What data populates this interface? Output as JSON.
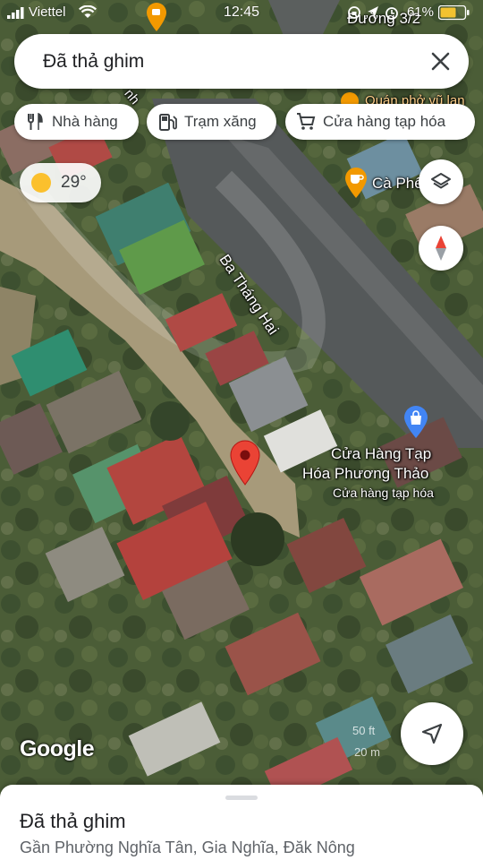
{
  "status_bar": {
    "carrier": "Viettel",
    "time": "12:45",
    "battery": "61%"
  },
  "search": {
    "query": "Đã thả ghim"
  },
  "chips": [
    {
      "label": "Nhà hàng",
      "icon": "restaurant-icon"
    },
    {
      "label": "Trạm xăng",
      "icon": "gas-station-icon"
    },
    {
      "label": "Cửa hàng tạp hóa",
      "icon": "shopping-cart-icon"
    }
  ],
  "weather": {
    "temperature": "29°",
    "icon": "sun-icon"
  },
  "map": {
    "street_labels": {
      "top_right": "Đường 3/2",
      "diagonal": "Ba Tháng Hai",
      "top_left": "nh"
    },
    "places": {
      "noodle_shop": "Quán phở vũ lan",
      "cafe": "Cà Phê",
      "store_name": "Cửa Hàng Tạp Hóa Phương Thảo",
      "store_line1": "Cửa Hàng Tạp",
      "store_line2": "Hóa Phương Thảo",
      "store_category": "Cửa hàng tạp hóa"
    },
    "scale": {
      "feet": "50 ft",
      "meters": "20 m"
    },
    "logo": "Google"
  },
  "controls": {
    "layers": "layers-icon",
    "compass": "compass-icon",
    "my_location": "navigation-arrow-icon"
  },
  "colors": {
    "pin_red": "#ea4335",
    "cafe_orange": "#f29900",
    "shop_blue": "#4285f4",
    "compass_red": "#ea4335"
  },
  "place_sheet": {
    "title": "Đã thả ghim",
    "address": "Gần Phường Nghĩa Tân, Gia Nghĩa, Đăk Nông"
  }
}
